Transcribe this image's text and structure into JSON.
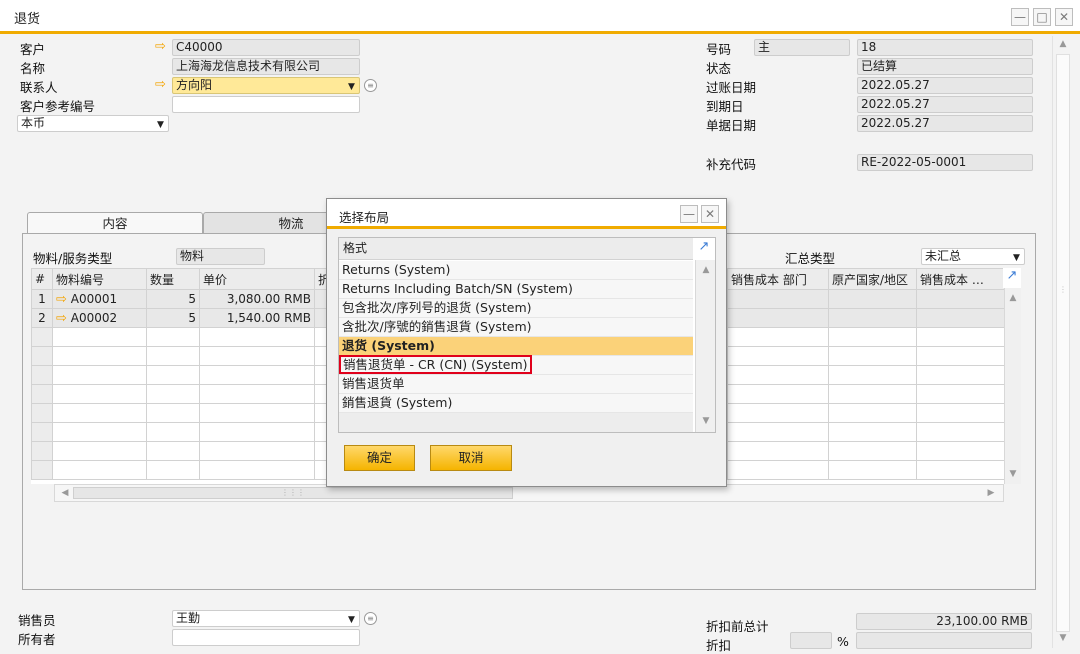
{
  "window": {
    "title": "退货",
    "minimize": "—",
    "maximize": "□",
    "close": "✕"
  },
  "header_left": {
    "customer_label": "客户",
    "customer_value": "C40000",
    "name_label": "名称",
    "name_value": "上海海龙信息技术有限公司",
    "contact_label": "联系人",
    "contact_value": "方向阳",
    "ref_label": "客户参考编号",
    "ref_value": "",
    "currency_value": "本币"
  },
  "header_right": {
    "number_label": "号码",
    "number_series": "主",
    "number_value": "18",
    "status_label": "状态",
    "status_value": "已结算",
    "posting_label": "过账日期",
    "posting_value": "2022.05.27",
    "due_label": "到期日",
    "due_value": "2022.05.27",
    "doc_date_label": "单据日期",
    "doc_date_value": "2022.05.27",
    "supp_label": "补充代码",
    "supp_value": "RE-2022-05-0001"
  },
  "tabs": [
    {
      "label": "内容"
    },
    {
      "label": "物流"
    }
  ],
  "content": {
    "item_type_label": "物料/服务类型",
    "item_type_value": "物料",
    "summary_label": "汇总类型",
    "summary_value": "未汇总",
    "left_columns": [
      "#",
      "物料编号",
      "数量",
      "单价",
      "折"
    ],
    "right_columns": [
      "销售成本 部门",
      "原产国家/地区",
      "销售成本 …"
    ],
    "rows": [
      {
        "num": "1",
        "item": "A00001",
        "qty": "5",
        "price": "3,080.00 RMB"
      },
      {
        "num": "2",
        "item": "A00002",
        "qty": "5",
        "price": "1,540.00 RMB"
      }
    ]
  },
  "footer": {
    "sales_label": "销售员",
    "sales_value": "王勤",
    "owner_label": "所有者",
    "owner_value": "",
    "total_label": "折扣前总计",
    "total_value": "23,100.00 RMB",
    "discount_label": "折扣",
    "discount_unit": "%"
  },
  "dialog": {
    "title": "选择布局",
    "header": "格式",
    "items": [
      {
        "label": "Returns (System)"
      },
      {
        "label": "Returns Including Batch/SN (System)"
      },
      {
        "label": "包含批次/序列号的退货 (System)"
      },
      {
        "label": "含批次/序號的銷售退貨 (System)"
      },
      {
        "label": "退货 (System)"
      },
      {
        "label": "销售退货单 - CR (CN) (System)"
      },
      {
        "label": "销售退货单"
      },
      {
        "label": "銷售退貨 (System)"
      }
    ],
    "ok": "确定",
    "cancel": "取消"
  },
  "colors": {
    "accent": "#f0ab00",
    "highlight": "#e0001b",
    "selected_row": "#fbd279"
  }
}
